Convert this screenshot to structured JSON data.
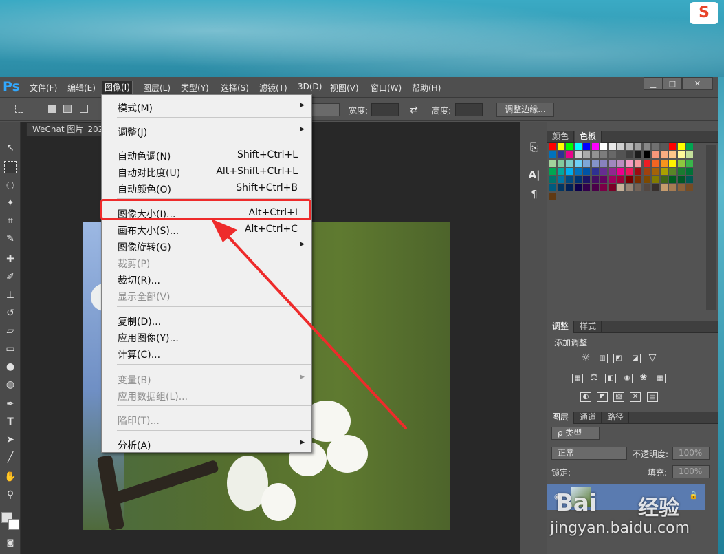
{
  "app": {
    "logo": "Ps",
    "overlay_logo": "S",
    "window_controls": {
      "minimize": "▁",
      "restore": "□",
      "close": "✕"
    }
  },
  "menubar": {
    "items": [
      "文件(F)",
      "编辑(E)",
      "图像(I)",
      "图层(L)",
      "类型(Y)",
      "选择(S)",
      "滤镜(T)",
      "3D(D)",
      "视图(V)",
      "窗口(W)",
      "帮助(H)"
    ],
    "active": "图像(I)"
  },
  "options_bar": {
    "width_label": "宽度:",
    "height_label": "高度:",
    "swap_icon": "⇄",
    "refine_edge_button": "调整边缘..."
  },
  "document": {
    "tab_title": "WeChat 图片_2021"
  },
  "image_menu": {
    "items": [
      {
        "label": "模式(M)",
        "shortcut": "",
        "submenu": true,
        "enabled": true
      },
      {
        "label": "调整(J)",
        "shortcut": "",
        "submenu": true,
        "enabled": true
      },
      {
        "label": "自动色调(N)",
        "shortcut": "Shift+Ctrl+L",
        "submenu": false,
        "enabled": true
      },
      {
        "label": "自动对比度(U)",
        "shortcut": "Alt+Shift+Ctrl+L",
        "submenu": false,
        "enabled": true
      },
      {
        "label": "自动颜色(O)",
        "shortcut": "Shift+Ctrl+B",
        "submenu": false,
        "enabled": true
      },
      {
        "label": "图像大小(I)...",
        "shortcut": "Alt+Ctrl+I",
        "submenu": false,
        "enabled": true,
        "highlighted": true
      },
      {
        "label": "画布大小(S)...",
        "shortcut": "Alt+Ctrl+C",
        "submenu": false,
        "enabled": true
      },
      {
        "label": "图像旋转(G)",
        "shortcut": "",
        "submenu": true,
        "enabled": true
      },
      {
        "label": "裁剪(P)",
        "shortcut": "",
        "submenu": false,
        "enabled": false
      },
      {
        "label": "裁切(R)...",
        "shortcut": "",
        "submenu": false,
        "enabled": true
      },
      {
        "label": "显示全部(V)",
        "shortcut": "",
        "submenu": false,
        "enabled": false
      },
      {
        "label": "复制(D)...",
        "shortcut": "",
        "submenu": false,
        "enabled": true
      },
      {
        "label": "应用图像(Y)...",
        "shortcut": "",
        "submenu": false,
        "enabled": true
      },
      {
        "label": "计算(C)...",
        "shortcut": "",
        "submenu": false,
        "enabled": true
      },
      {
        "label": "变量(B)",
        "shortcut": "",
        "submenu": true,
        "enabled": false
      },
      {
        "label": "应用数据组(L)...",
        "shortcut": "",
        "submenu": false,
        "enabled": false
      },
      {
        "label": "陷印(T)...",
        "shortcut": "",
        "submenu": false,
        "enabled": false
      },
      {
        "label": "分析(A)",
        "shortcut": "",
        "submenu": true,
        "enabled": true
      }
    ]
  },
  "panels": {
    "color_tabs": [
      "颜色",
      "色板"
    ],
    "color_active": "色板",
    "adjust_tabs": [
      "调整",
      "样式"
    ],
    "adjust_active": "调整",
    "adjust_title": "添加调整",
    "layers_tabs": [
      "图层",
      "通道",
      "路径"
    ],
    "layers_active": "图层",
    "filter_kind": "ρ 类型",
    "blend_mode": "正常",
    "opacity_label": "不透明度:",
    "opacity_value": "100%",
    "lock_label": "锁定:",
    "fill_label": "填充:",
    "fill_value": "100%"
  },
  "watermark": {
    "logo": "Bai",
    "logo_suffix": "经验",
    "url": "jingyan.baidu.com"
  },
  "colors": {
    "highlight": "#ee2b2b",
    "ps_blue": "#31a8ff",
    "menu_bg": "#f0f0f0"
  },
  "swatches": [
    "#ff0000",
    "#ffff00",
    "#00ff00",
    "#00ffff",
    "#0000ff",
    "#ff00ff",
    "#ffffff",
    "#e8e8e8",
    "#d0d0d0",
    "#b8b8b8",
    "#a0a0a0",
    "#888888",
    "#707070",
    "#585858",
    "#ff0000",
    "#ffff00",
    "#00a651",
    "#0072bc",
    "#2e3192",
    "#ec008c",
    "#cfcfcf",
    "#aaaaaa",
    "#939393",
    "#7d7d7d",
    "#686868",
    "#535353",
    "#3f3f3f",
    "#1c1c1c",
    "#000000",
    "#f7977a",
    "#f9ad81",
    "#fdc68a",
    "#fff79a",
    "#c4df9b",
    "#a3d39c",
    "#82ca9d",
    "#7bcdc8",
    "#6ecff6",
    "#7ea7d8",
    "#8493ca",
    "#8882be",
    "#a187be",
    "#bc8dbf",
    "#f49ac2",
    "#f6989d",
    "#ed1c24",
    "#f26522",
    "#f7941d",
    "#fff200",
    "#8dc73f",
    "#39b54a",
    "#00a651",
    "#00a99d",
    "#00aeef",
    "#0072bc",
    "#0054a6",
    "#2e3192",
    "#662d91",
    "#92278f",
    "#ec008c",
    "#ed145b",
    "#9e0b0f",
    "#a0410d",
    "#a36209",
    "#aba000",
    "#598527",
    "#197b30",
    "#007236",
    "#00746b",
    "#0076a3",
    "#004b80",
    "#003471",
    "#1b1464",
    "#440e62",
    "#630460",
    "#9e005d",
    "#9e0039",
    "#790000",
    "#7b2e00",
    "#7d4900",
    "#827b00",
    "#406618",
    "#005e20",
    "#005826",
    "#005952",
    "#005b7f",
    "#003663",
    "#002157",
    "#0d004c",
    "#32004b",
    "#4b0049",
    "#7b0046",
    "#7a0026",
    "#c7b299",
    "#998675",
    "#736357",
    "#534741",
    "#37302d",
    "#c69c6d",
    "#a67c52",
    "#8c6239",
    "#754c24",
    "#603913"
  ]
}
